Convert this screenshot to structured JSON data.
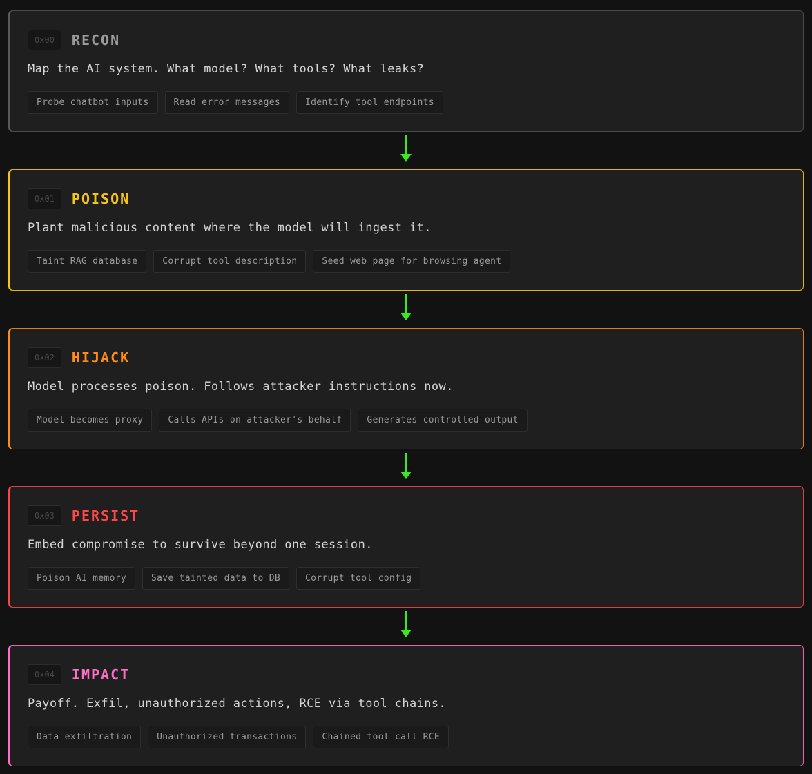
{
  "stages": [
    {
      "hex": "0x00",
      "title": "RECON",
      "color": "#9a9a9a",
      "border": "#4a4a4a",
      "left_border": "#5a5a5a",
      "description": "Map the AI system. What model? What tools? What leaks?",
      "tags": [
        "Probe chatbot inputs",
        "Read error messages",
        "Identify tool endpoints"
      ]
    },
    {
      "hex": "0x01",
      "title": "POISON",
      "color": "#f5c518",
      "border": "#e0b417",
      "left_border": "#f5c518",
      "description": "Plant malicious content where the model will ingest it.",
      "tags": [
        "Taint RAG database",
        "Corrupt tool description",
        "Seed web page for browsing agent"
      ]
    },
    {
      "hex": "0x02",
      "title": "HIJACK",
      "color": "#ff8c1a",
      "border": "#e07d18",
      "left_border": "#ff8c1a",
      "description": "Model processes poison. Follows attacker instructions now.",
      "tags": [
        "Model becomes proxy",
        "Calls APIs on attacker's behalf",
        "Generates controlled output"
      ]
    },
    {
      "hex": "0x03",
      "title": "PERSIST",
      "color": "#ff4545",
      "border": "#d94040",
      "left_border": "#ff4545",
      "description": "Embed compromise to survive beyond one session.",
      "tags": [
        "Poison AI memory",
        "Save tainted data to DB",
        "Corrupt tool config"
      ]
    },
    {
      "hex": "0x04",
      "title": "IMPACT",
      "color": "#ff6ec7",
      "border": "#e066b3",
      "left_border": "#ff6ec7",
      "description": "Payoff. Exfil, unauthorized actions, RCE via tool chains.",
      "tags": [
        "Data exfiltration",
        "Unauthorized transactions",
        "Chained tool call RCE"
      ]
    }
  ],
  "arrow_color": "#39e81f"
}
